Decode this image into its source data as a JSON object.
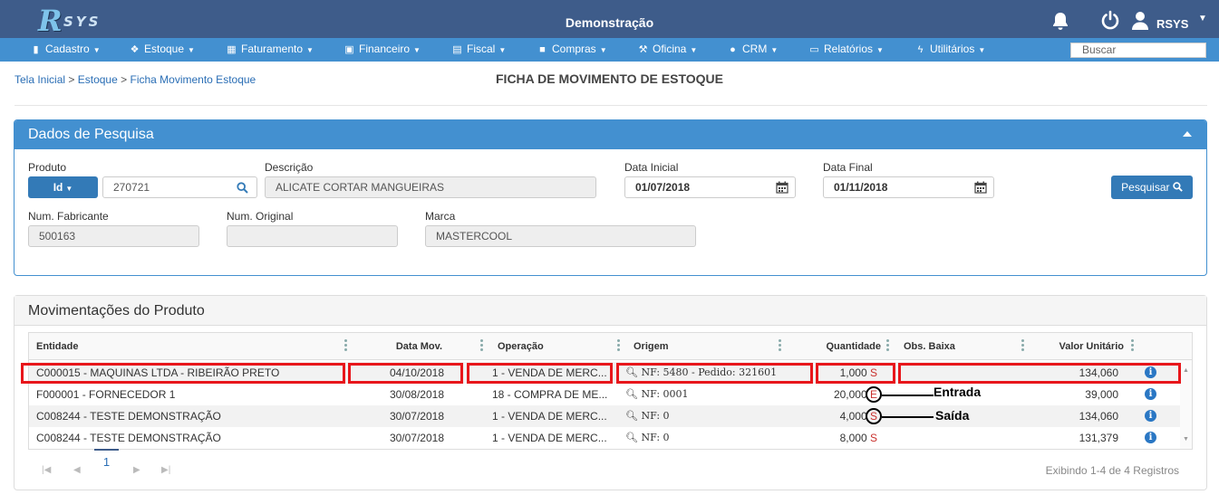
{
  "app": {
    "logo_r": "R",
    "logo_sys": "SYS",
    "title": "Demonstração",
    "user": "RSYS"
  },
  "nav": [
    {
      "label": "Cadastro",
      "icon": "book-icon"
    },
    {
      "label": "Estoque",
      "icon": "cubes-icon"
    },
    {
      "label": "Faturamento",
      "icon": "calculator-icon"
    },
    {
      "label": "Financeiro",
      "icon": "money-icon"
    },
    {
      "label": "Fiscal",
      "icon": "file-icon"
    },
    {
      "label": "Compras",
      "icon": "truck-icon"
    },
    {
      "label": "Oficina",
      "icon": "wrench-icon"
    },
    {
      "label": "CRM",
      "icon": "users-icon"
    },
    {
      "label": "Relatórios",
      "icon": "print-icon"
    },
    {
      "label": "Utilitários",
      "icon": "bolt-icon"
    }
  ],
  "search_nav": {
    "placeholder": "Buscar"
  },
  "breadcrumb": {
    "home": "Tela Inicial",
    "section": "Estoque",
    "page": "Ficha Movimento Estoque"
  },
  "page_title": "FICHA DE MOVIMENTO DE ESTOQUE",
  "search_panel": {
    "title": "Dados de Pesquisa",
    "produto_label": "Produto",
    "id_button": "Id",
    "produto_value": "270721",
    "descricao_label": "Descrição",
    "descricao_value": "ALICATE CORTAR MANGUEIRAS",
    "data_inicial_label": "Data Inicial",
    "data_inicial_value": "01/07/2018",
    "data_final_label": "Data Final",
    "data_final_value": "01/11/2018",
    "pesquisar_button": "Pesquisar",
    "num_fabricante_label": "Num. Fabricante",
    "num_fabricante_value": "500163",
    "num_original_label": "Num. Original",
    "num_original_value": "",
    "marca_label": "Marca",
    "marca_value": "MASTERCOOL"
  },
  "movements": {
    "title": "Movimentações do Produto",
    "columns": {
      "entidade": "Entidade",
      "data_mov": "Data Mov.",
      "operacao": "Operação",
      "origem": "Origem",
      "quantidade": "Quantidade",
      "obs_baixa": "Obs. Baixa",
      "valor_unitario": "Valor Unitário"
    },
    "rows": [
      {
        "entidade": "C000015 - MAQUINAS LTDA - RIBEIRÃO PRETO",
        "data": "04/10/2018",
        "operacao": "1 - VENDA DE MERC...",
        "origem": "NF: 5480 - Pedido: 321601",
        "quantidade": "1,000",
        "es": "S",
        "obs": "",
        "valor": "134,060"
      },
      {
        "entidade": "F000001 - FORNECEDOR 1",
        "data": "30/08/2018",
        "operacao": "18 - COMPRA DE ME...",
        "origem": "NF: 0001",
        "quantidade": "20,000",
        "es": "E",
        "obs": "",
        "valor": "39,000"
      },
      {
        "entidade": "C008244 - TESTE DEMONSTRAÇÃO",
        "data": "30/07/2018",
        "operacao": "1 - VENDA DE MERC...",
        "origem": "NF: 0",
        "quantidade": "4,000",
        "es": "S",
        "obs": "",
        "valor": "134,060"
      },
      {
        "entidade": "C008244 - TESTE DEMONSTRAÇÃO",
        "data": "30/07/2018",
        "operacao": "1 - VENDA DE MERC...",
        "origem": "NF: 0",
        "quantidade": "8,000",
        "es": "S",
        "obs": "",
        "valor": "131,379"
      }
    ],
    "pager": {
      "page": "1",
      "info": "Exibindo 1-4 de 4 Registros"
    }
  },
  "annotations": {
    "entrada": "Entrada",
    "saida": "Saída"
  },
  "colors": {
    "topbar": "#3e5c8a",
    "navbar": "#4390d0",
    "primary": "#337ab7",
    "highlight": "#e8161b",
    "es_marker": "#c9302c"
  }
}
